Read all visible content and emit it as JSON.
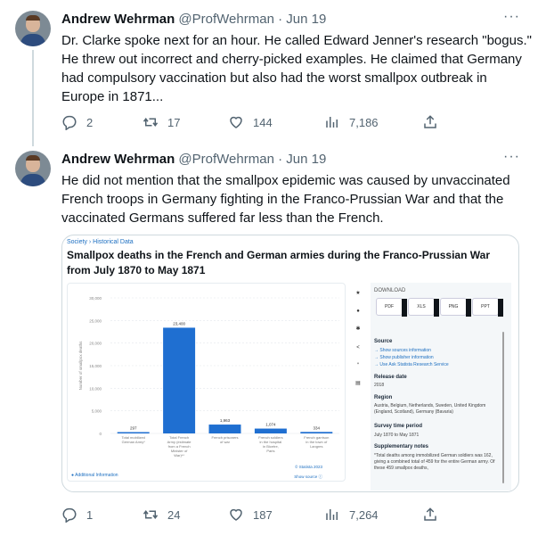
{
  "tweets": [
    {
      "name": "Andrew Wehrman",
      "handle": "@ProfWehrman",
      "dot": "·",
      "date": "Jun 19",
      "text": "Dr. Clarke spoke next for an hour. He called Edward Jenner's research \"bogus.\" He threw out incorrect and cherry-picked examples. He claimed that Germany had compulsory vaccination but also had the worst smallpox outbreak in Europe in 1871...",
      "replies": "2",
      "retweets": "17",
      "likes": "144",
      "views": "7,186"
    },
    {
      "name": "Andrew Wehrman",
      "handle": "@ProfWehrman",
      "dot": "·",
      "date": "Jun 19",
      "text": "He did not mention that the smallpox epidemic was caused by unvaccinated French troops in Germany fighting in the Franco-Prussian War and that the vaccinated Germans suffered far less than the French.",
      "replies": "1",
      "retweets": "24",
      "likes": "187",
      "views": "7,264"
    }
  ],
  "card": {
    "breadcrumb": "Society › Historical Data",
    "title": "Smallpox deaths in the French and German armies during the Franco-Prussian War from July 1870 to May 1871",
    "download_label": "DOWNLOAD",
    "downloads": [
      "PDF",
      "XLS",
      "PNG",
      "PPT"
    ],
    "source_heading": "Source",
    "source_links": [
      "→ Show sources information",
      "→ Show publisher information",
      "→ Use Ask Statista Research Service"
    ],
    "release_heading": "Release date",
    "release_value": "2018",
    "region_heading": "Region",
    "region_value": "Austria, Belgium, Netherlands, Sweden, United Kingdom (England, Scotland), Germany (Bavaria)",
    "survey_heading": "Survey time period",
    "survey_value": "July 1870 to May 1871",
    "notes_heading": "Supplementary notes",
    "notes_value": "*Total deaths among immobilized German soldiers was 162, giving a combined total of 459 for the entire German army. Of these 459 smallpox deaths,",
    "additional_info": "Additional Information",
    "statista_credit": "© Statista 2023",
    "show_source": "Show source"
  },
  "chart_data": {
    "type": "bar",
    "ylabel": "Number of smallpox deaths",
    "ylim": [
      0,
      30000
    ],
    "yticks": [
      "0",
      "5,000",
      "10,000",
      "15,000",
      "20,000",
      "25,000",
      "30,000"
    ],
    "categories": [
      "Total mobilized German Army*",
      "Total French Army (estimate from a French Minister of War)**",
      "French prisoners of war",
      "French soldiers in the hospital in Bicetre, Paris",
      "French garrison in the town of Langres"
    ],
    "values": [
      297,
      23400,
      1963,
      1074,
      334
    ],
    "value_labels": [
      "297",
      "23,400",
      "1,963",
      "1,074",
      "334"
    ],
    "colors": {
      "bar": "#1f6fd1"
    }
  },
  "colors": {
    "link": "#1d6fc1",
    "muted": "#536471",
    "border": "#cfd9de"
  }
}
